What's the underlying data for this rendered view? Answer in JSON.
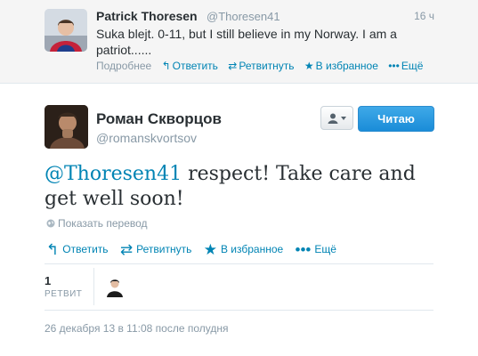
{
  "parent_tweet": {
    "name": "Patrick Thoresen",
    "handle": "@Thoresen41",
    "time": "16 ч",
    "text": "Suka blejt. 0-11, but I still believe in my Norway.  I am a patriot......",
    "actions": {
      "details": "Подробнее",
      "reply": "Ответить",
      "retweet": "Ретвитнуть",
      "favorite": "В избранное",
      "more": "Ещё"
    }
  },
  "tweet": {
    "name": "Роман Скворцов",
    "handle": "@romanskvortsov",
    "mention": "@Thoresen41",
    "text": " respect! Take care and get well soon!",
    "translate": "Показать перевод",
    "actions": {
      "reply": "Ответить",
      "retweet": "Ретвитнуть",
      "favorite": "В избранное",
      "more": "Ещё"
    },
    "follow_label": "Читаю",
    "retweet_count": "1",
    "retweet_label": "РЕТВИТ",
    "timestamp": "26 декабря 13 в 11:08 после полудня"
  },
  "icons": {
    "reply": "reply-icon",
    "retweet": "retweet-icon",
    "favorite": "star-icon",
    "more": "more-dots-icon",
    "translate": "globe-icon",
    "user": "user-icon"
  },
  "colors": {
    "accent": "#0084b4",
    "follow_button": "#2b9be0",
    "muted": "#8899a6",
    "parent_background": "#f5f5f5"
  }
}
